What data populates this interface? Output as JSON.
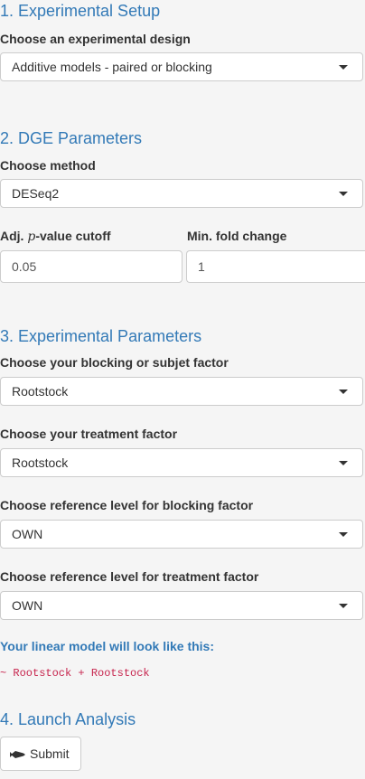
{
  "section1": {
    "title": "1. Experimental Setup",
    "design_label": "Choose an experimental design",
    "design_value": "Additive models - paired or blocking"
  },
  "section2": {
    "title": "2. DGE Parameters",
    "method_label": "Choose method",
    "method_value": "DESeq2",
    "pvalue_label_prefix": "Adj. ",
    "pvalue_label_p": "p",
    "pvalue_label_suffix": "-value cutoff",
    "pvalue_value": "0.05",
    "fold_label": "Min. fold change",
    "fold_value": "1"
  },
  "section3": {
    "title": "3. Experimental Parameters",
    "blocking_label": "Choose your blocking or subjet factor",
    "blocking_value": "Rootstock",
    "treatment_label": "Choose your treatment factor",
    "treatment_value": "Rootstock",
    "ref_blocking_label": "Choose reference level for blocking factor",
    "ref_blocking_value": "OWN",
    "ref_treatment_label": "Choose reference level for treatment factor",
    "ref_treatment_value": "OWN",
    "model_label": "Your linear model will look like this:",
    "formula": "~ Rootstock + Rootstock"
  },
  "section4": {
    "title": "4. Launch Analysis",
    "submit_label": "Submit"
  },
  "icons": {
    "submit_icon": "rocket-icon",
    "dropdown_icon": "caret-down-icon"
  },
  "colors": {
    "heading": "#337ab7",
    "formula": "#c7254e",
    "background": "#f5f5f5"
  }
}
